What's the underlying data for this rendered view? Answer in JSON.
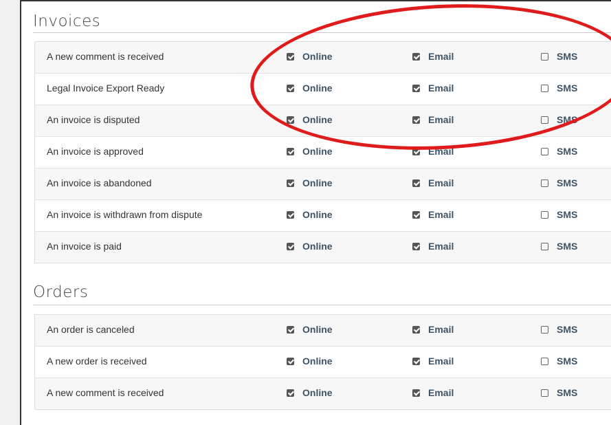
{
  "sections": [
    {
      "title": "Invoices",
      "rows": [
        {
          "label": "A new comment is received",
          "online": true,
          "email": true,
          "sms": false
        },
        {
          "label": "Legal Invoice Export Ready",
          "online": true,
          "email": true,
          "sms": false
        },
        {
          "label": "An invoice is disputed",
          "online": true,
          "email": true,
          "sms": false
        },
        {
          "label": "An invoice is approved",
          "online": true,
          "email": true,
          "sms": false
        },
        {
          "label": "An invoice is abandoned",
          "online": true,
          "email": true,
          "sms": false
        },
        {
          "label": "An invoice is withdrawn from dispute",
          "online": true,
          "email": true,
          "sms": false
        },
        {
          "label": "An invoice is paid",
          "online": true,
          "email": true,
          "sms": false
        }
      ]
    },
    {
      "title": "Orders",
      "rows": [
        {
          "label": "An order is canceled",
          "online": true,
          "email": true,
          "sms": false
        },
        {
          "label": "A new order is received",
          "online": true,
          "email": true,
          "sms": false
        },
        {
          "label": "A new comment is received",
          "online": true,
          "email": true,
          "sms": false
        }
      ]
    }
  ],
  "option_labels": {
    "online": "Online",
    "email": "Email",
    "sms": "SMS"
  },
  "colors": {
    "annotation": "#e01b1b",
    "option_text": "#3e5366"
  }
}
